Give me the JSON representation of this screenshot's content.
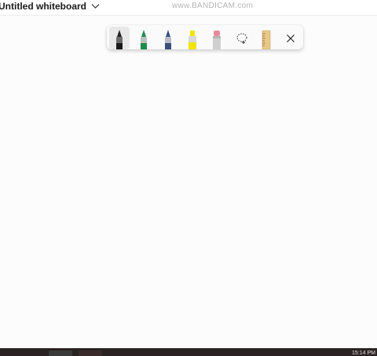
{
  "window": {
    "title": "Untitled whiteboard",
    "watermark": "www.BANDICAM.com"
  },
  "toolbar": {
    "tools": [
      {
        "name": "Black pen",
        "color": "#1a1a1a",
        "selected": true
      },
      {
        "name": "Green pen",
        "color": "#1e8a4c",
        "selected": false
      },
      {
        "name": "Blue pen",
        "color": "#3b4f7c",
        "selected": false
      },
      {
        "name": "Yellow highlighter",
        "color": "#f2e400",
        "selected": false
      },
      {
        "name": "Eraser",
        "color": "#e88a9a",
        "selected": false
      },
      {
        "name": "Lasso select",
        "icon": "lasso-icon"
      },
      {
        "name": "Ruler",
        "icon": "ruler-icon",
        "color": "#e7c98a"
      },
      {
        "name": "Close",
        "icon": "close-icon"
      }
    ]
  },
  "taskbar": {
    "background": "#2b2323",
    "clock": "15:14 PM"
  }
}
